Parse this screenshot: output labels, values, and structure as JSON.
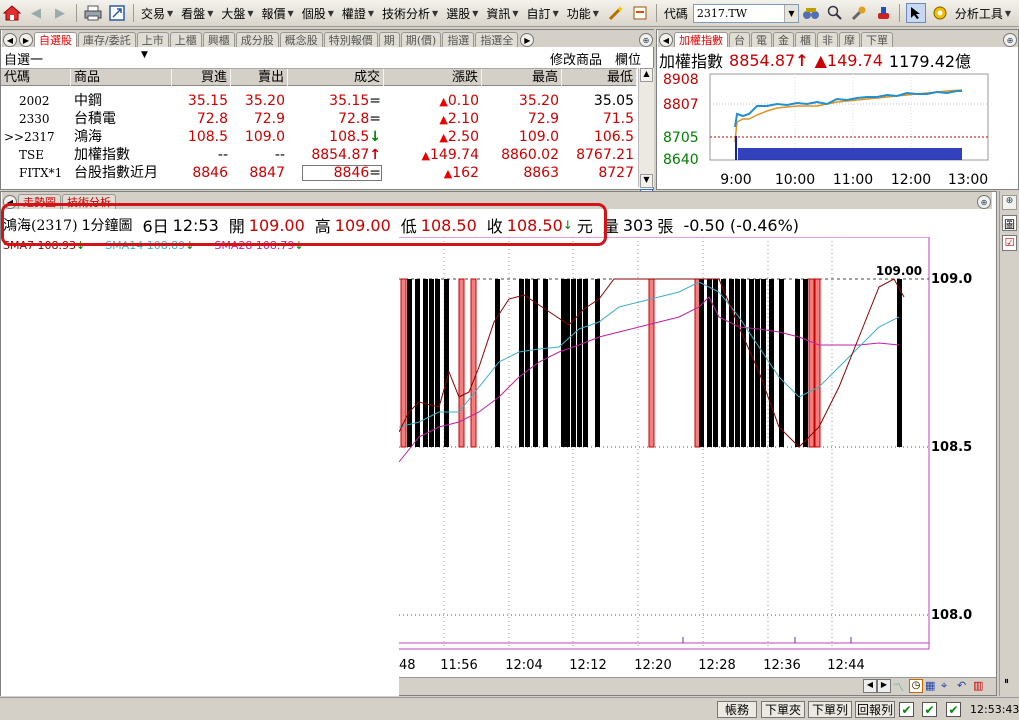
{
  "toolbar": {
    "menus": [
      "交易",
      "看盤",
      "大盤",
      "報價",
      "個股",
      "權證",
      "技術分析",
      "選股",
      "資訊",
      "自訂",
      "功能"
    ],
    "code_label": "代碼",
    "code_value": "2317.TW",
    "analysis_tools": "分析工具"
  },
  "quote_panel": {
    "tabs": [
      "自選股",
      "庫存/委託",
      "上市",
      "上櫃",
      "興櫃",
      "成分股",
      "概念股",
      "特別報價",
      "期",
      "期(價)",
      "指選",
      "指選全"
    ],
    "group_name": "自選一",
    "modify_label": "修改商品",
    "field_label": "欄位",
    "columns": [
      "代碼",
      "商品",
      "買進",
      "賣出",
      "成交",
      "漲跌",
      "最高",
      "最低"
    ],
    "rows": [
      {
        "code": "2002",
        "name": "中鋼",
        "bid": "35.15",
        "ask": "35.20",
        "last": "35.15",
        "last_mark": "=",
        "change": "0.10",
        "high": "35.20",
        "low": "35.05"
      },
      {
        "code": "2330",
        "name": "台積電",
        "bid": "72.8",
        "ask": "72.9",
        "last": "72.8",
        "last_mark": "=",
        "change": "2.10",
        "high": "72.9",
        "low": "71.5"
      },
      {
        "code": ">>2317",
        "name": "鴻海",
        "bid": "108.5",
        "ask": "109.0",
        "last": "108.5",
        "last_mark": "↓",
        "change": "2.50",
        "high": "109.0",
        "low": "106.5"
      },
      {
        "code": "TSE",
        "name": "加權指數",
        "bid": "--",
        "ask": "--",
        "last": "8854.87",
        "last_mark": "↑",
        "change": "149.74",
        "high": "8860.02",
        "low": "8767.21"
      },
      {
        "code": "FITX*1",
        "name": "台股指數近月",
        "bid": "8846",
        "ask": "8847",
        "last": "8846",
        "last_mark": "=",
        "change": "162",
        "high": "8863",
        "low": "8727"
      }
    ]
  },
  "index_panel": {
    "tabs": [
      "加權指數",
      "台",
      "電",
      "金",
      "櫃",
      "非",
      "摩",
      "下單"
    ],
    "name": "加權指數",
    "value": "8854.87",
    "value_mark": "↑",
    "change": "149.74",
    "turnover": "1179.42億",
    "y_ticks": [
      "8908",
      "8807",
      "8705",
      "8640"
    ],
    "x_ticks": [
      "9:00",
      "10:00",
      "11:00",
      "12:00",
      "13:00"
    ]
  },
  "chart_panel": {
    "tabs": [
      "走勢圖",
      "技術分析"
    ],
    "stock": "鴻海(2317)",
    "period": "1分鐘圖",
    "date": "6日",
    "time": "12:53",
    "open_label": "開",
    "open": "109.00",
    "high_label": "高",
    "high": "109.00",
    "low_label": "低",
    "low": "108.50",
    "close_label": "收",
    "close": "108.50",
    "close_mark": "↓",
    "unit": "元",
    "volume_label": "量",
    "volume": "303",
    "volume_unit": "張",
    "change_text": "-0.50 (-0.46%)",
    "sma": [
      {
        "label": "SMA7 108.93",
        "mark": "↓"
      },
      {
        "label": "SMA14 108.89",
        "mark": "↓"
      },
      {
        "label": "SMA28 108.79",
        "mark": "↓"
      }
    ],
    "price_ticks": [
      "109.0",
      "108.5",
      "108.0"
    ],
    "last_label": "109.00",
    "time_ticks": [
      "48",
      "11:56",
      "12:04",
      "12:12",
      "12:20",
      "12:28",
      "12:36",
      "12:44"
    ],
    "right_tab": "圖"
  },
  "status_bar": {
    "buttons": [
      "帳務",
      "下單夾",
      "下單列",
      "回報列"
    ],
    "clock": "12:53:43"
  },
  "colors": {
    "accent_red": "#d01418",
    "price_red": "#c00000",
    "index_green": "#008000"
  }
}
